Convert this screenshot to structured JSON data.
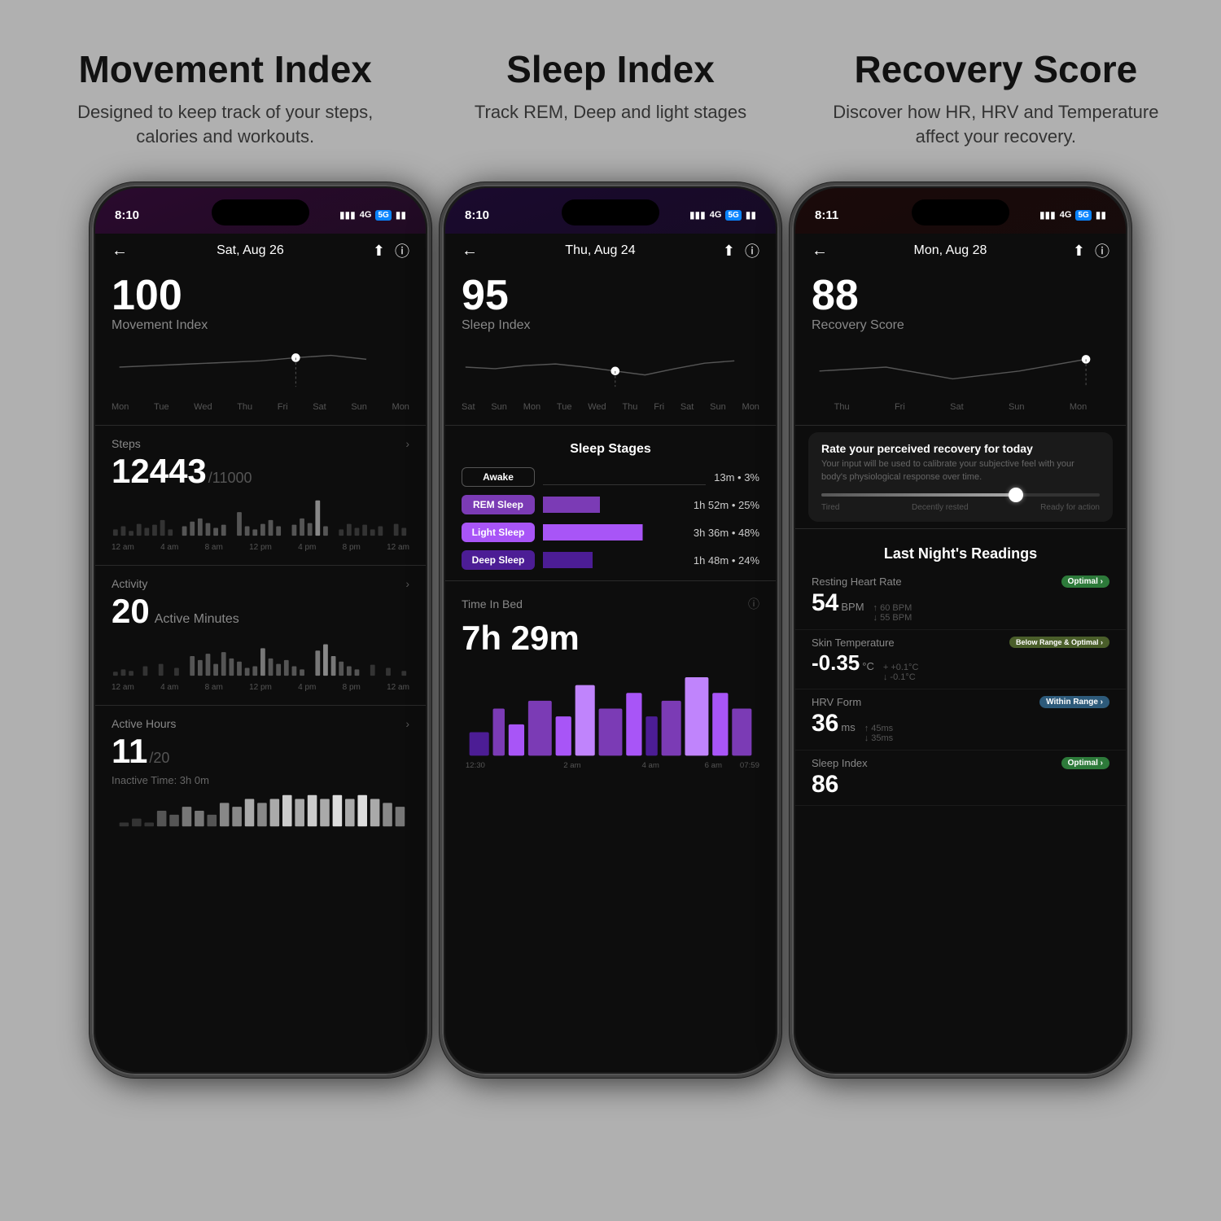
{
  "header": {
    "col1": {
      "title": "Movement Index",
      "desc": "Designed to keep track of your steps, calories and workouts."
    },
    "col2": {
      "title": "Sleep Index",
      "desc": "Track REM, Deep and light stages"
    },
    "col3": {
      "title": "Recovery Score",
      "desc": "Discover how HR, HRV and Temperature affect your recovery."
    }
  },
  "phone1": {
    "time": "8:10",
    "date": "Sat, Aug 26",
    "score": "100",
    "scoreLabel": "Movement Index",
    "chartDays": [
      "Mon",
      "Tue",
      "Wed",
      "Thu",
      "Fri",
      "Sat",
      "Sun",
      "Mon"
    ],
    "stepsLabel": "Steps",
    "stepsValue": "12443",
    "stepsTarget": "/11000",
    "activityLabel": "Activity",
    "activityValue": "20",
    "activityUnit": "Active Minutes",
    "activeHoursLabel": "Active Hours",
    "activeHoursValue": "11",
    "activeHoursTarget": "/20",
    "inactiveTime": "Inactive Time: 3h 0m",
    "barLabels": [
      "12 am",
      "4 am",
      "8 am",
      "12 pm",
      "4 pm",
      "8 pm",
      "12 am"
    ]
  },
  "phone2": {
    "time": "8:10",
    "date": "Thu, Aug 24",
    "score": "95",
    "scoreLabel": "Sleep Index",
    "chartDays": [
      "Sat",
      "Sun",
      "Mon",
      "Tue",
      "Wed",
      "Thu",
      "Fri",
      "Sat",
      "Sun",
      "Mon"
    ],
    "stagesTitle": "Sleep Stages",
    "stages": [
      {
        "label": "Awake",
        "type": "awake",
        "time": "13m",
        "pct": "3%"
      },
      {
        "label": "REM Sleep",
        "type": "rem",
        "time": "1h 52m",
        "pct": "25%"
      },
      {
        "label": "Light Sleep",
        "type": "light",
        "time": "3h 36m",
        "pct": "48%"
      },
      {
        "label": "Deep Sleep",
        "type": "deep",
        "time": "1h 48m",
        "pct": "24%"
      }
    ],
    "timeBedLabel": "Time In Bed",
    "timeBedValue": "7h 29m",
    "timeStart": "12:30",
    "timeEnd": "07:59",
    "barLabels": [
      "",
      "2 am",
      "",
      "4 am",
      "",
      "6 am",
      ""
    ]
  },
  "phone3": {
    "time": "8:11",
    "date": "Mon, Aug 28",
    "score": "88",
    "scoreLabel": "Recovery Score",
    "chartDays": [
      "Thu",
      "Fri",
      "Sat",
      "Sun",
      "Mon"
    ],
    "rateTitle": "Rate your perceived recovery for today",
    "rateDesc": "Your input will be used to calibrate your subjective feel with your body's physiological response over time.",
    "sliderLabels": [
      "Tired",
      "Decently rested",
      "Ready for action"
    ],
    "readingsTitle": "Last Night's Readings",
    "readings": [
      {
        "label": "Resting Heart Rate",
        "badge": "Optimal",
        "badgeType": "optimal",
        "value": "54",
        "unit": "BPM",
        "sub1": "↑ 60 BPM",
        "sub2": "↓ 55 BPM"
      },
      {
        "label": "Skin Temperature",
        "badge": "Below Range & Optimal",
        "badgeType": "below",
        "value": "-0.35",
        "unit": "°C",
        "sub1": "+ +0.1°C",
        "sub2": "↓ -0.1°C"
      },
      {
        "label": "HRV Form",
        "badge": "Within Range",
        "badgeType": "within",
        "value": "36",
        "unit": "ms",
        "sub1": "↑ 45ms",
        "sub2": "↓ 35ms"
      },
      {
        "label": "Sleep Index",
        "badge": "Optimal",
        "badgeType": "optimal",
        "value": "86",
        "unit": "",
        "sub1": "",
        "sub2": ""
      }
    ]
  }
}
